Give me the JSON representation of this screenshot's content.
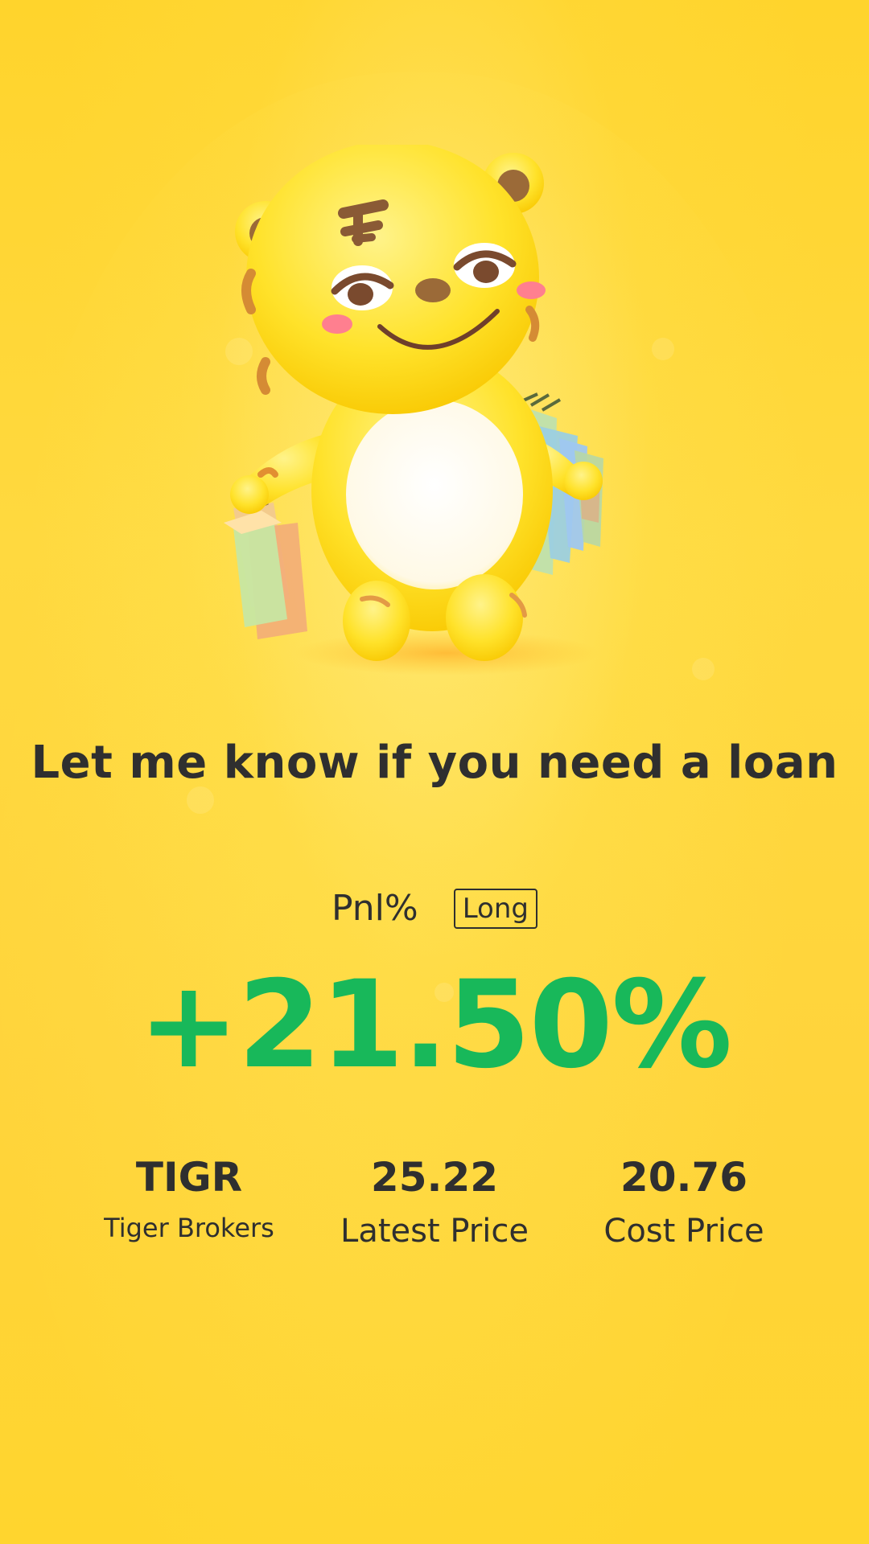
{
  "headline": "Let me know if you need a loan",
  "position": {
    "label": "Pnl%",
    "side": "Long"
  },
  "pnl": {
    "value": "+21.50%",
    "color": "#18b85a"
  },
  "stats": [
    {
      "value": "TIGR",
      "label": "Tiger Brokers"
    },
    {
      "value": "25.22",
      "label": "Latest Price"
    },
    {
      "value": "20.76",
      "label": "Cost Price"
    }
  ],
  "colors": {
    "background": "#ffd42c",
    "text": "#2f2f2f",
    "positive": "#18b85a"
  },
  "icons": {
    "mascot": "tiger-mascot-with-shopping-bags"
  }
}
